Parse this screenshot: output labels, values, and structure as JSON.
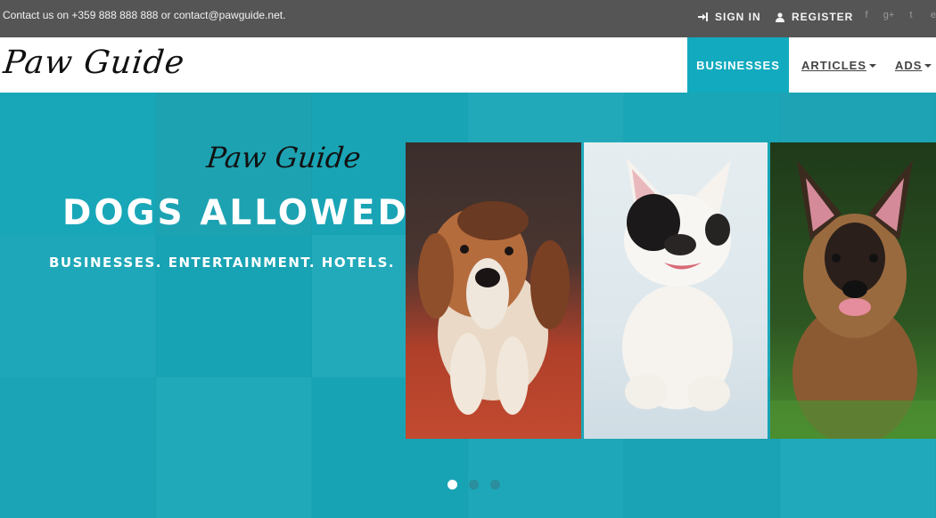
{
  "topbar": {
    "contact": "Contact us on +359 888 888 888 or contact@pawguide.net.",
    "sign_in": "SIGN IN",
    "register": "REGISTER",
    "social": [
      "f",
      "g+",
      "t",
      "e"
    ]
  },
  "header": {
    "logo": "Paw Guide",
    "nav": {
      "businesses": "BUSINESSES",
      "articles": "ARTICLES",
      "ads": "ADS"
    }
  },
  "hero": {
    "script": "Paw Guide",
    "title": "DOGS ALLOWED",
    "subtitle": "BUSINESSES. ENTERTAINMENT. HOTELS.",
    "slides_total": 3,
    "active_slide": 1
  },
  "colors": {
    "accent": "#12aabf",
    "topbar": "#555555",
    "hero_bg": "#17b1c2"
  }
}
